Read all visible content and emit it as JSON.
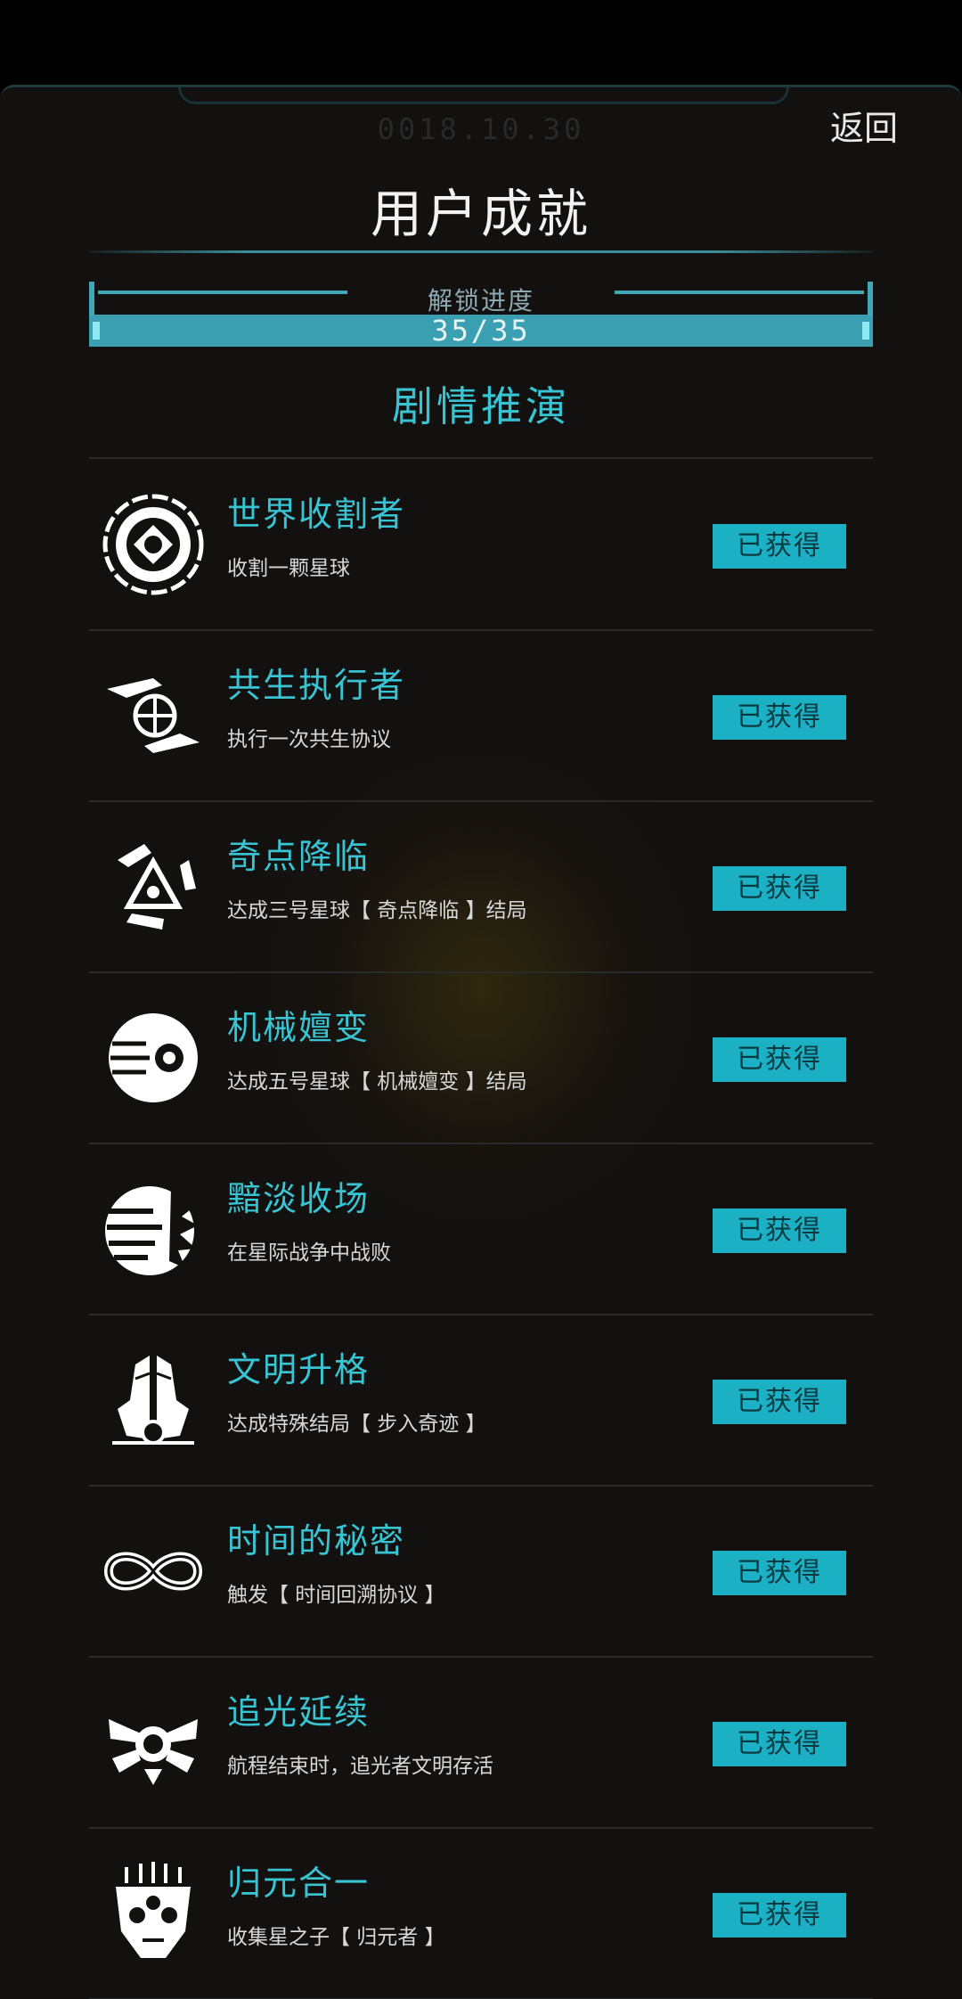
{
  "header": {
    "date": "0018.10.30",
    "back_label": "返回",
    "title": "用户成就"
  },
  "progress": {
    "label": "解锁进度",
    "text": "35/35",
    "fraction": 1.0
  },
  "section": {
    "title": "剧情推演"
  },
  "achievements": [
    {
      "title": "世界收割者",
      "desc": "收割一颗星球",
      "status": "已获得",
      "icon": "planet-harvest-icon"
    },
    {
      "title": "共生执行者",
      "desc": "执行一次共生协议",
      "status": "已获得",
      "icon": "symbiosis-hands-icon"
    },
    {
      "title": "奇点降临",
      "desc": "达成三号星球【 奇点降临 】结局",
      "status": "已获得",
      "icon": "singularity-triangle-icon"
    },
    {
      "title": "机械嬗变",
      "desc": "达成五号星球【 机械嬗变 】结局",
      "status": "已获得",
      "icon": "mechanical-eye-icon"
    },
    {
      "title": "黯淡收场",
      "desc": "在星际战争中战败",
      "status": "已获得",
      "icon": "shattered-sphere-icon"
    },
    {
      "title": "文明升格",
      "desc": "达成特殊结局【 步入奇迹 】",
      "status": "已获得",
      "icon": "winged-emblem-icon"
    },
    {
      "title": "时间的秘密",
      "desc": "触发【 时间回溯协议 】",
      "status": "已获得",
      "icon": "infinity-icon"
    },
    {
      "title": "追光延续",
      "desc": "航程结束时，追光者文明存活",
      "status": "已获得",
      "icon": "winged-core-icon"
    },
    {
      "title": "归元合一",
      "desc": "收集星之子【 归元者 】",
      "status": "已获得",
      "icon": "robot-mask-icon"
    }
  ]
}
